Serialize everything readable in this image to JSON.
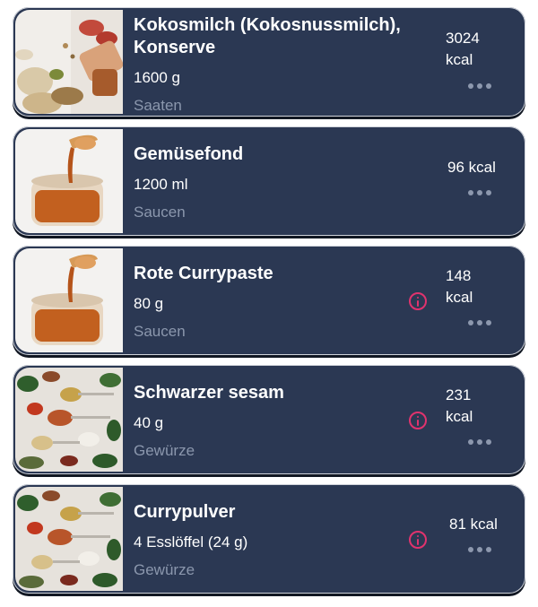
{
  "items": [
    {
      "name": "Kokosmilch (Kokosnussmilch), Konserve",
      "quantity": "1600 g",
      "category": "Saaten",
      "kcal": "3024 kcal",
      "info": false,
      "image": "nuts-seeds-image"
    },
    {
      "name": "Gemüsefond",
      "quantity": "1200 ml",
      "category": "Saucen",
      "kcal": "96 kcal",
      "info": false,
      "image": "sauce-jar-image"
    },
    {
      "name": "Rote Currypaste",
      "quantity": "80 g",
      "category": "Saucen",
      "kcal": "148 kcal",
      "info": true,
      "image": "sauce-jar-image"
    },
    {
      "name": "Schwarzer sesam",
      "quantity": "40 g",
      "category": "Gewürze",
      "kcal": "231 kcal",
      "info": true,
      "image": "spices-spoons-image"
    },
    {
      "name": "Currypulver",
      "quantity": "4 Esslöffel (24 g)",
      "category": "Gewürze",
      "kcal": "81 kcal",
      "info": true,
      "image": "spices-spoons-image"
    }
  ],
  "icons": {
    "info": "info-icon",
    "more": "more-dots-icon"
  },
  "colors": {
    "card_bg": "#2b3853",
    "muted_text": "#8b97ad",
    "info_accent": "#e0336e",
    "page_bg": "#ffffff"
  }
}
